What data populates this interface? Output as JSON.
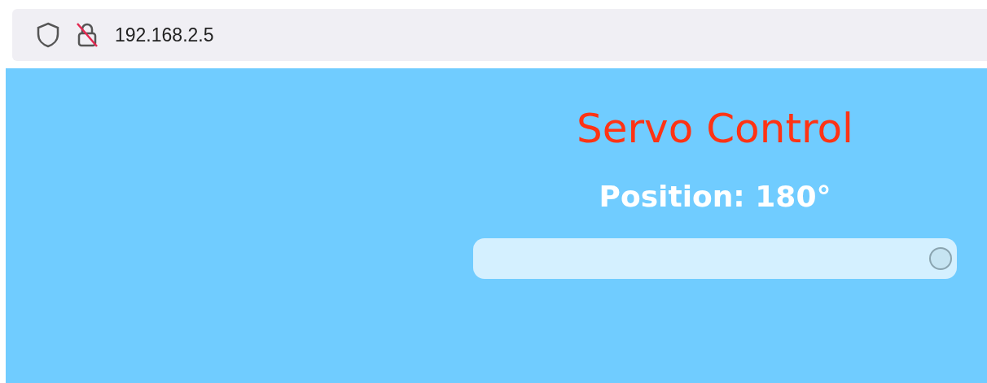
{
  "address_bar": {
    "url": "192.168.2.5"
  },
  "page": {
    "title": "Servo Control",
    "position_label": "Position: 180°",
    "slider": {
      "level": 1.0
    }
  }
}
